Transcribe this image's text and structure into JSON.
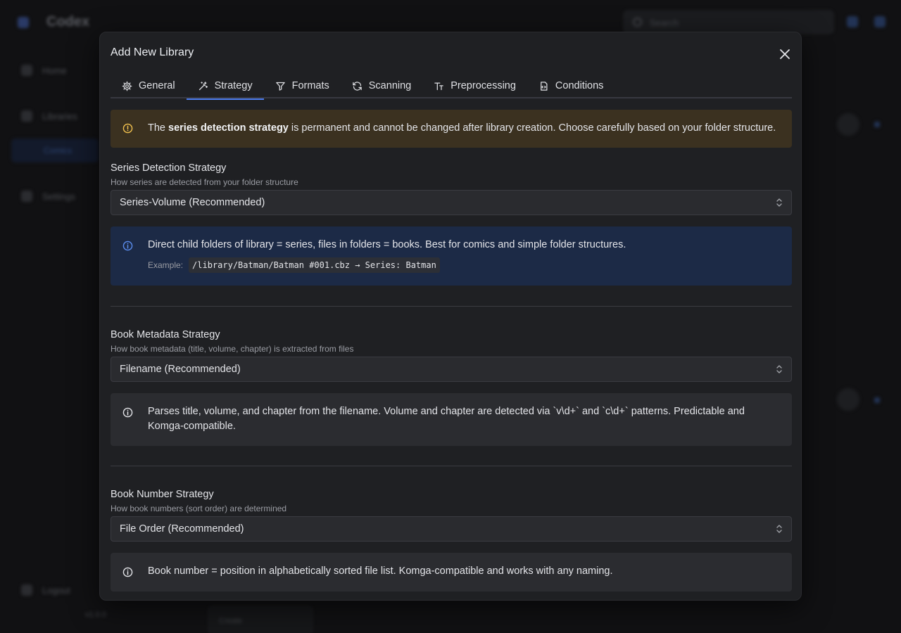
{
  "background": {
    "app_name": "Codex",
    "search_placeholder": "Search",
    "sidebar": [
      "Home",
      "Libraries",
      "Settings",
      "Logout"
    ],
    "sidebar_active": "Comics",
    "version": "v1.0.0",
    "card_label": "Create"
  },
  "modal": {
    "title": "Add New Library",
    "tabs": [
      {
        "label": "General",
        "icon": "gear-icon"
      },
      {
        "label": "Strategy",
        "icon": "wand-icon"
      },
      {
        "label": "Formats",
        "icon": "filter-icon"
      },
      {
        "label": "Scanning",
        "icon": "refresh-icon"
      },
      {
        "label": "Preprocessing",
        "icon": "text-type-icon"
      },
      {
        "label": "Conditions",
        "icon": "file-code-icon"
      }
    ],
    "active_tab": "Strategy",
    "warning": {
      "prefix": "The ",
      "bold": "series detection strategy",
      "suffix": " is permanent and cannot be changed after library creation. Choose carefully based on your folder structure."
    },
    "series": {
      "label": "Series Detection Strategy",
      "description": "How series are detected from your folder structure",
      "value": "Series-Volume (Recommended)",
      "info": "Direct child folders of library = series, files in folders = books. Best for comics and simple folder structures.",
      "example_label": "Example:",
      "example_code": "/library/Batman/Batman #001.cbz → Series: Batman"
    },
    "book_metadata": {
      "label": "Book Metadata Strategy",
      "description": "How book metadata (title, volume, chapter) is extracted from files",
      "value": "Filename (Recommended)",
      "info": "Parses title, volume, and chapter from the filename. Volume and chapter are detected via `v\\d+` and `c\\d+` patterns. Predictable and Komga-compatible."
    },
    "book_number": {
      "label": "Book Number Strategy",
      "description": "How book numbers (sort order) are determined",
      "value": "File Order (Recommended)",
      "info": "Book number = position in alphabetically sorted file list. Komga-compatible and works with any naming."
    }
  },
  "colors": {
    "accent": "#4c7cf0",
    "warning_icon": "#f2c14e",
    "info_icon": "#5b8def"
  }
}
